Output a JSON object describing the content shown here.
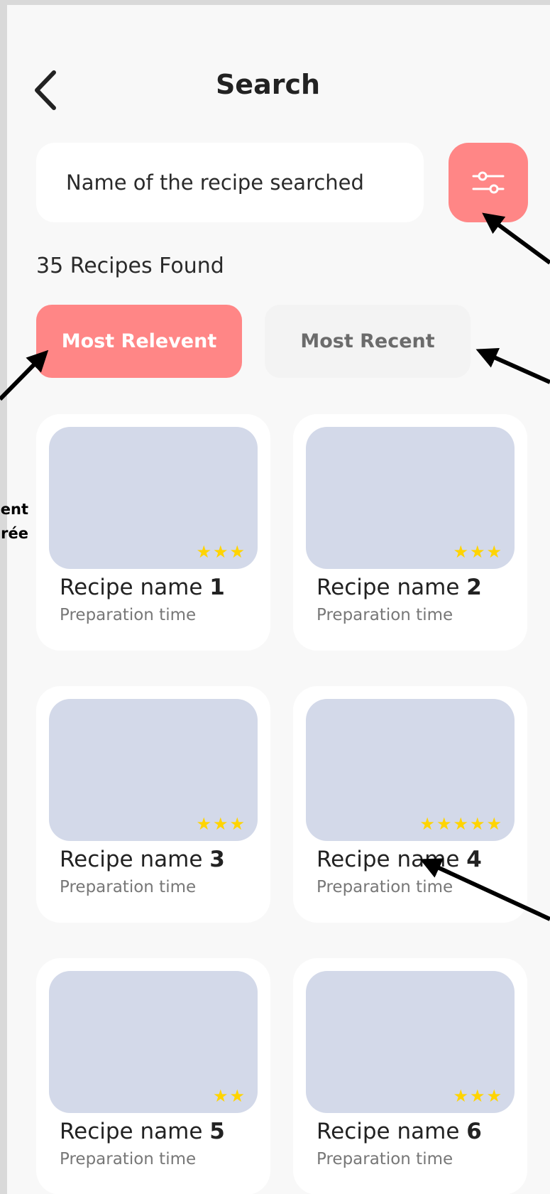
{
  "header": {
    "title": "Search"
  },
  "search": {
    "value": "Name of the recipe searched"
  },
  "results": {
    "count_text": "35 Recipes Found"
  },
  "tabs": [
    {
      "label": "Most Relevent",
      "active": true
    },
    {
      "label": "Most Recent",
      "active": false
    }
  ],
  "recipes": [
    {
      "name": "Recipe name ",
      "number": "1",
      "time": "Preparation time",
      "stars": "★★★"
    },
    {
      "name": "Recipe name ",
      "number": "2",
      "time": "Preparation time",
      "stars": "★★★"
    },
    {
      "name": "Recipe name ",
      "number": "3",
      "time": "Preparation time",
      "stars": "★★★"
    },
    {
      "name": "Recipe name ",
      "number": "4",
      "time": "Preparation time",
      "stars": "★★★★★"
    },
    {
      "name": "Recipe name ",
      "number": "5",
      "time": "Preparation time",
      "stars": "★★"
    },
    {
      "name": "Recipe name ",
      "number": "6",
      "time": "Preparation time",
      "stars": "★★★"
    }
  ],
  "annotations": {
    "left_note_line1": "ent",
    "left_note_line2": "rée"
  },
  "colors": {
    "accent": "#ff8686",
    "thumb": "#d3d9e9",
    "star": "#ffd400",
    "background": "#f8f8f8"
  },
  "icons": {
    "back": "chevron-left-icon",
    "filter": "sliders-icon",
    "star": "star-icon"
  }
}
